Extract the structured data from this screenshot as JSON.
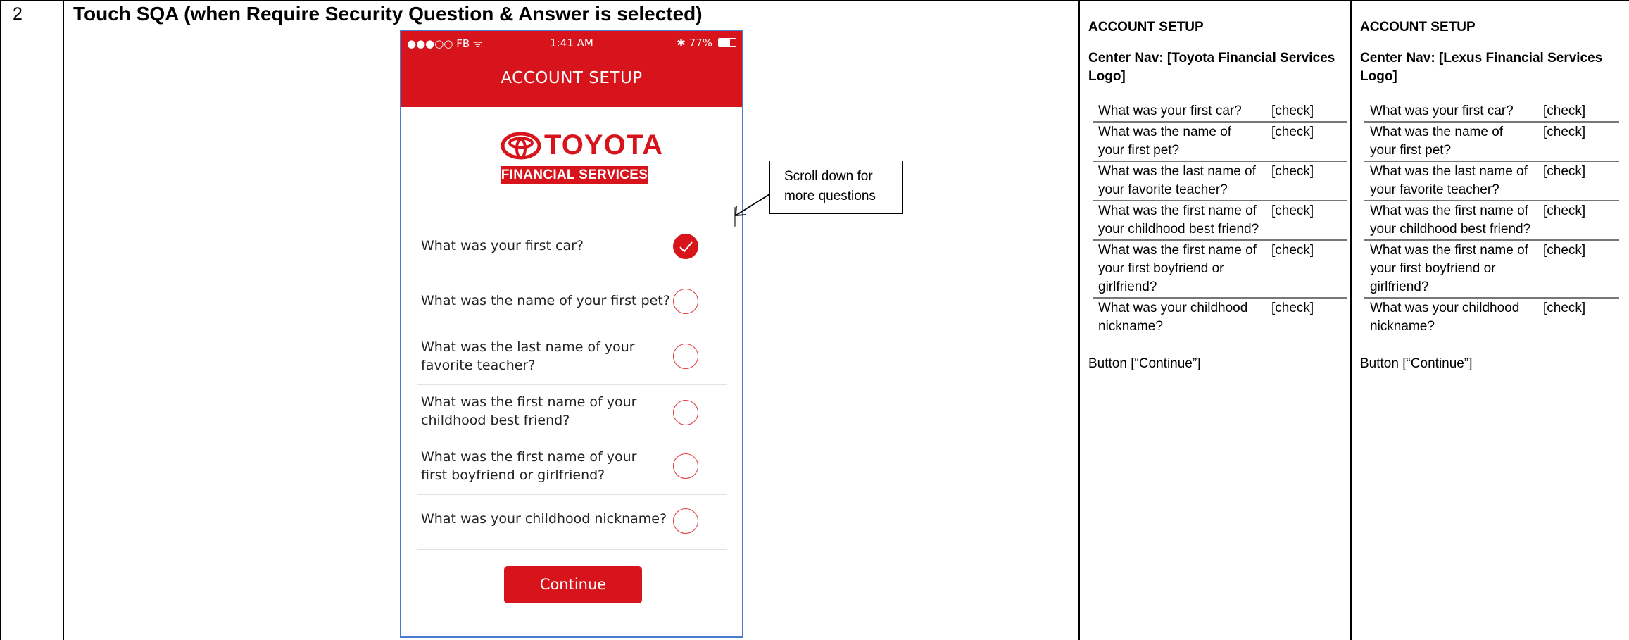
{
  "row": {
    "number": "2",
    "heading": "Touch SQA (when Require Security Question & Answer is selected)"
  },
  "phone": {
    "status_left": "●●●○○ FB ᯤ",
    "time": "1:41 AM",
    "battery": "77%",
    "battery_level": 0.77,
    "title": "ACCOUNT SETUP",
    "logo_word": "TOYOTA",
    "logo_sub": "FINANCIAL SERVICES",
    "questions": [
      {
        "text": "What was your first car?",
        "checked": true
      },
      {
        "text": "What was the name of your first pet?",
        "checked": false
      },
      {
        "text": "What was the last name of your favorite teacher?",
        "checked": false
      },
      {
        "text": "What was the first name of your childhood best friend?",
        "checked": false
      },
      {
        "text": "What was the first name of your first boyfriend or girlfriend?",
        "checked": false
      },
      {
        "text": "What was your childhood nickname?",
        "checked": false
      }
    ],
    "continue_label": "Continue",
    "accent_color": "#d7141c"
  },
  "callout": {
    "text": "Scroll down for more questions"
  },
  "spec_toyota": {
    "title": "ACCOUNT SETUP",
    "nav": "Center Nav:  [Toyota Financial Services Logo]",
    "rows": [
      {
        "q": "What was your first car?",
        "a": "[check]"
      },
      {
        "q": "What was the name of your first pet?",
        "a": "[check]"
      },
      {
        "q": "What was the last name of your favorite teacher?",
        "a": "[check]"
      },
      {
        "q": "What was the first name of your childhood best friend?",
        "a": "[check]"
      },
      {
        "q": "What was the first name of your first boyfriend or girlfriend?",
        "a": "[check]"
      },
      {
        "q": "What was your childhood nickname?",
        "a": "[check]"
      }
    ],
    "button": "Button [“Continue”]"
  },
  "spec_lexus": {
    "title": "ACCOUNT SETUP",
    "nav": "Center Nav:  [Lexus Financial Services Logo]",
    "rows": [
      {
        "q": "What was your first car?",
        "a": "[check]"
      },
      {
        "q": "What was the name of your first pet?",
        "a": "[check]"
      },
      {
        "q": "What was the last name of your favorite teacher?",
        "a": "[check]"
      },
      {
        "q": "What was the first name of your childhood best friend?",
        "a": "[check]"
      },
      {
        "q": "What was the first name of your first boyfriend or girlfriend?",
        "a": "[check]"
      },
      {
        "q": "What was your childhood nickname?",
        "a": "[check]"
      }
    ],
    "button": "Button [“Continue”]"
  }
}
